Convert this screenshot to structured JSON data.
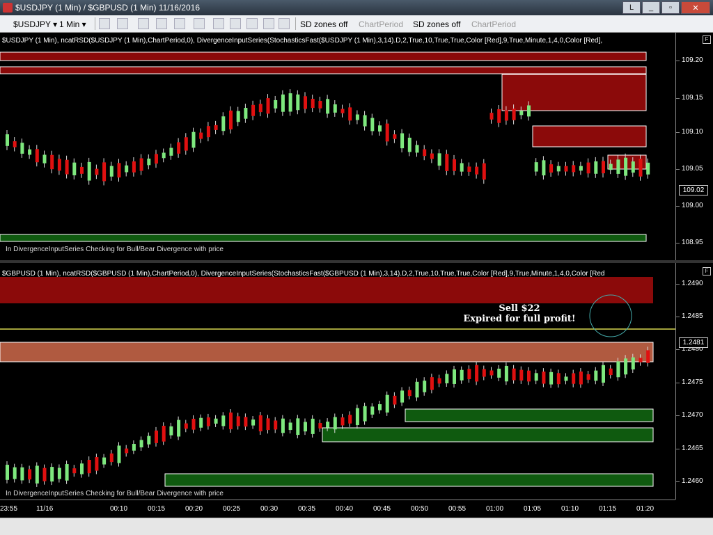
{
  "window": {
    "title": "$USDJPY (1 Min) / $GBPUSD (1 Min)  11/16/2016",
    "minimize": "_",
    "restore": "▫",
    "close": "✕",
    "mode_button": "L"
  },
  "toolbar": {
    "symbol": "$USDJPY",
    "interval": "1 Min",
    "sd_zones_1": "SD zones off",
    "chart_period_1": "ChartPeriod",
    "sd_zones_2": "SD zones off",
    "chart_period_2": "ChartPeriod"
  },
  "panes": [
    {
      "study_label": "$USDJPY (1 Min), ncatRSD($USDJPY (1 Min),ChartPeriod,0), DivergenceInputSeries(StochasticsFast($USDJPY (1 Min),3,14).D,2,True,10,True,True,Color [Red],9,True,Minute,1,4,0,Color [Red],",
      "status": "In DivergenceInputSeries Checking for Bull/Bear Divergence with price",
      "price_labels": [
        "109.20",
        "109.15",
        "109.10",
        "109.05",
        "109.00",
        "108.95"
      ],
      "current_price": "109.02",
      "f_button": "F"
    },
    {
      "study_label": "$GBPUSD (1 Min), ncatRSD($GBPUSD (1 Min),ChartPeriod,0), DivergenceInputSeries(StochasticsFast($GBPUSD (1 Min),3,14).D,2,True,10,True,True,Color [Red],9,True,Minute,1,4,0,Color [Red",
      "status": "In DivergenceInputSeries Checking for Bull/Bear Divergence with price",
      "price_labels": [
        "1.2490",
        "1.2485",
        "1.2480",
        "1.2475",
        "1.2470",
        "1.2465",
        "1.2460"
      ],
      "current_price": "1.2481",
      "f_button": "F",
      "annotation": {
        "line1": "Sell $22",
        "line2": "Expired for full profit!"
      }
    }
  ],
  "time_axis": [
    "23:55",
    "11/16",
    "00:10",
    "00:15",
    "00:20",
    "00:25",
    "00:30",
    "00:35",
    "00:40",
    "00:45",
    "00:50",
    "00:55",
    "01:00",
    "01:05",
    "01:10",
    "01:15",
    "01:20"
  ],
  "colors": {
    "supply_zone": "#8b0a0a",
    "demand_zone": "#0f5a0f",
    "up_candle": "#7ee87e",
    "down_candle": "#e01010",
    "gbp_supply": "#b05a40",
    "price_line": "#d8d850"
  }
}
